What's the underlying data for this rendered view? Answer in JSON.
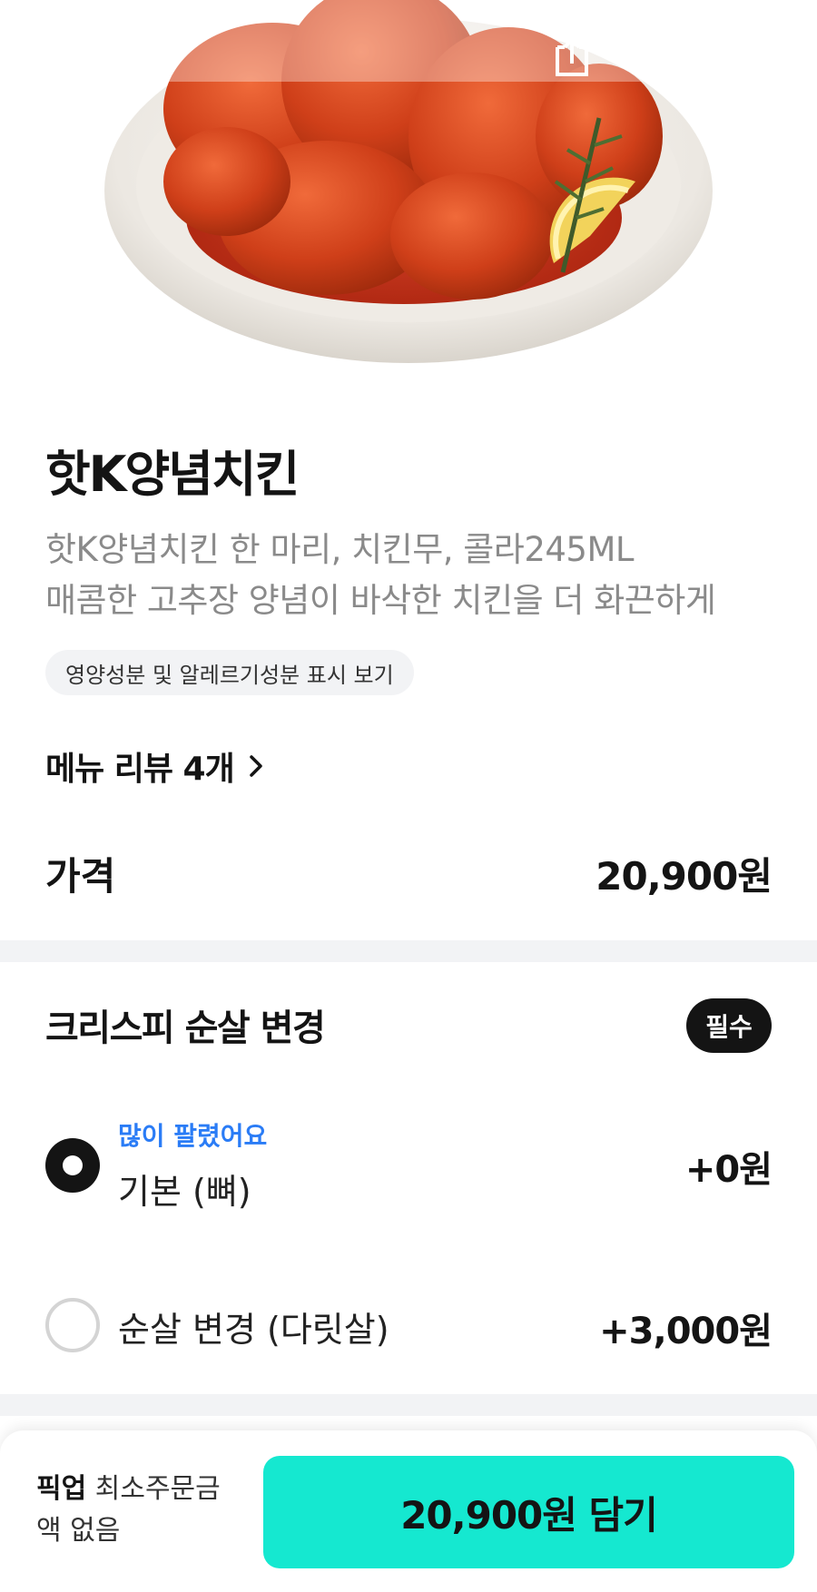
{
  "header": {
    "back_icon": "arrow-left-icon",
    "share_icon": "share-icon",
    "search_icon": "search-icon",
    "cart_icon": "cart-icon"
  },
  "product": {
    "image": "fried-chicken-plate",
    "name": "핫K양념치킨",
    "description_line1": "핫K양념치킨 한 마리, 치킨무, 콜라245ML",
    "description_line2": "매콤한 고추장 양념이 바삭한 치킨을 더 화끈하게",
    "nutrition_chip": "영양성분 및 알레르기성분 표시 보기",
    "review_link": "메뉴 리뷰 4개"
  },
  "price": {
    "label": "가격",
    "value": "20,900원"
  },
  "option_group": {
    "title": "크리스피 순살 변경",
    "required_badge": "필수",
    "options": [
      {
        "badge": "많이 팔렸어요",
        "label": "기본 (뼈)",
        "price": "+0원",
        "selected": true
      },
      {
        "badge": "",
        "label": "순살 변경 (다릿살)",
        "price": "+3,000원",
        "selected": false
      }
    ]
  },
  "bottom_bar": {
    "pickup_bold": "픽업",
    "pickup_text": " 최소주문금액 없음",
    "cart_button": "20,900원 담기"
  },
  "colors": {
    "accent": "#15e8d0",
    "badge_blue": "#2a7cf6",
    "text_dark": "#141414",
    "text_gray": "#8a8a8a"
  }
}
